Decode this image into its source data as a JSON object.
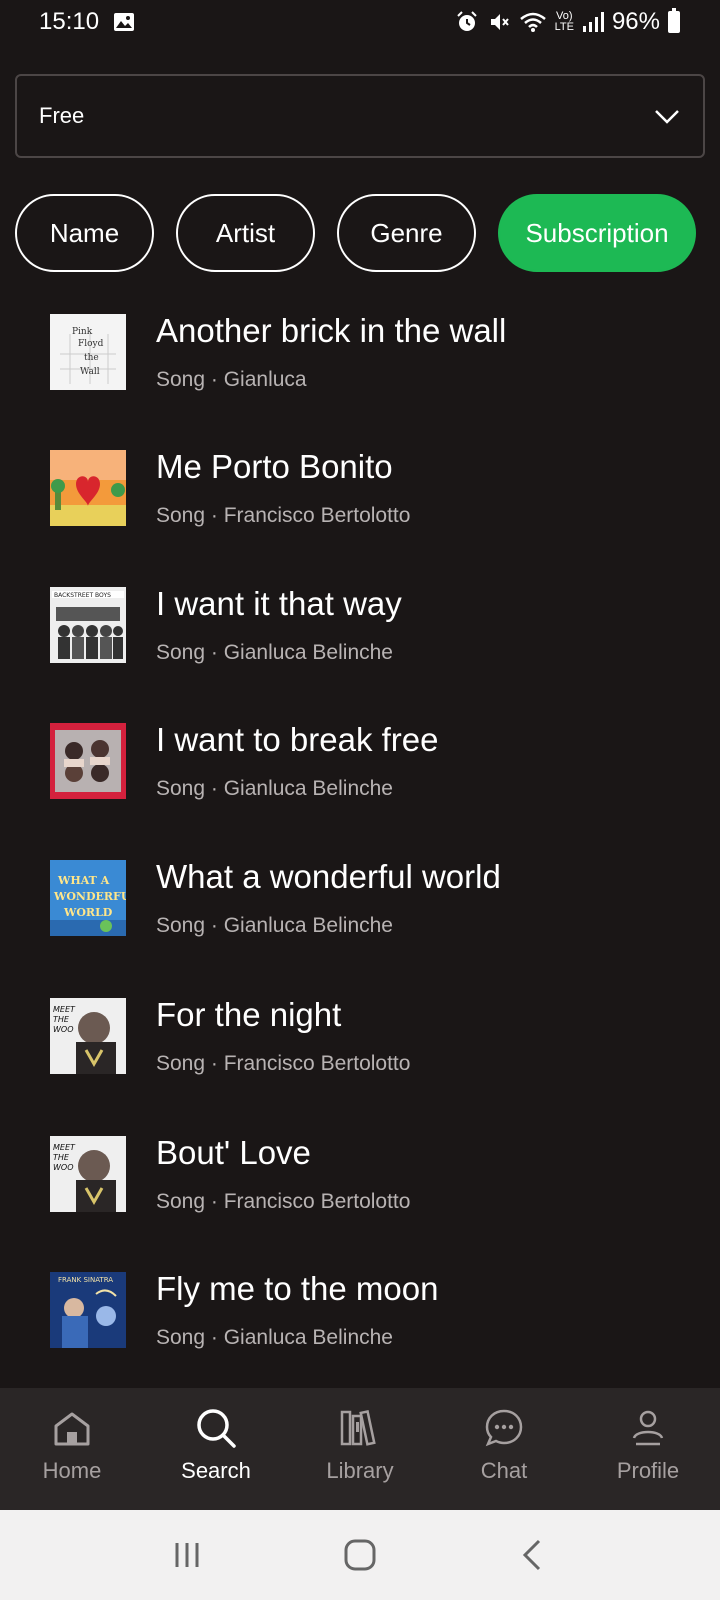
{
  "status_bar": {
    "time": "15:10",
    "battery": "96%",
    "network": "LTE"
  },
  "plan_select": {
    "value": "Free"
  },
  "filters": [
    {
      "label": "Name",
      "active": false
    },
    {
      "label": "Artist",
      "active": false
    },
    {
      "label": "Genre",
      "active": false
    },
    {
      "label": "Subscription",
      "active": true
    }
  ],
  "songs": [
    {
      "title": "Another brick in the wall",
      "subtitle": "Song · Gianluca",
      "cover": "another-brick-cover"
    },
    {
      "title": "Me Porto Bonito",
      "subtitle": "Song · Francisco Bertolotto",
      "cover": "me-porto-bonito-cover"
    },
    {
      "title": "I want it that way",
      "subtitle": "Song · Gianluca Belinche",
      "cover": "backstreet-boys-cover"
    },
    {
      "title": "I want to break free",
      "subtitle": "Song · Gianluca Belinche",
      "cover": "queen-cover"
    },
    {
      "title": "What a wonderful world",
      "subtitle": "Song · Gianluca Belinche",
      "cover": "wonderful-world-cover"
    },
    {
      "title": "For the night",
      "subtitle": "Song · Francisco Bertolotto",
      "cover": "meet-the-woo-cover"
    },
    {
      "title": "Bout' Love",
      "subtitle": "Song · Francisco Bertolotto",
      "cover": "meet-the-woo-cover"
    },
    {
      "title": "Fly me to the moon",
      "subtitle": "Song · Gianluca Belinche",
      "cover": "sinatra-cover"
    }
  ],
  "bottom_nav": [
    {
      "label": "Home",
      "icon": "home-icon",
      "active": false
    },
    {
      "label": "Search",
      "icon": "search-icon",
      "active": true
    },
    {
      "label": "Library",
      "icon": "library-icon",
      "active": false
    },
    {
      "label": "Chat",
      "icon": "chat-icon",
      "active": false
    },
    {
      "label": "Profile",
      "icon": "profile-icon",
      "active": false
    }
  ],
  "colors": {
    "background": "#1a1616",
    "accent": "#1db954",
    "nav_bg": "#2a2626",
    "muted": "#b8b3b3"
  }
}
